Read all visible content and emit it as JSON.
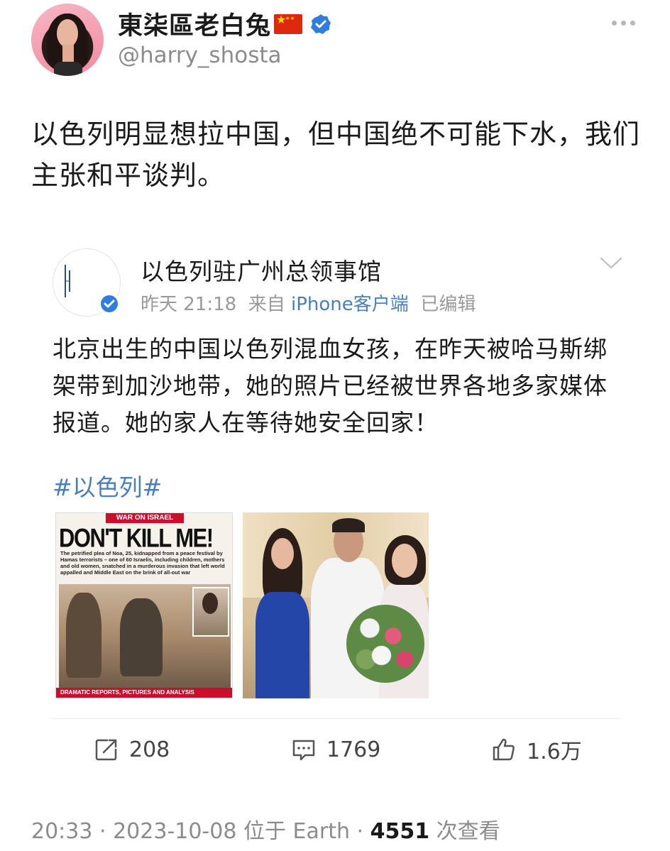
{
  "post": {
    "author": {
      "display_name": "東柒區老白兔",
      "handle": "@harry_shosta",
      "flag_icon": "china-flag-icon",
      "verified_icon": "verified-badge-icon"
    },
    "text": "以色列明显想拉中国，但中国绝不可能下水，我们主张和平谈判。",
    "quoted": {
      "author_name": "以色列驻广州总领事馆",
      "time": "昨天 21:18",
      "from_label": "来自",
      "client": "iPhone客户端",
      "edited": "已编辑",
      "text": "北京出生的中国以色列混血女孩，在昨天被哈马斯绑架带到加沙地带，她的照片已经被世界各地多家媒体报道。她的家人在等待她安全回家！",
      "hashtag": "#以色列#",
      "images": {
        "news": {
          "banner": "WAR ON ISRAEL",
          "headline": "DON'T KILL ME!",
          "subtext": "The petrified plea of Noa, 25, kidnapped from a peace festival by Hamas terrorists – one of 60 Israelis, including children, mothers and old women, snatched in a murderous invasion that left world appalled and Middle East on the brink of all-out war",
          "footer": "DRAMATIC REPORTS, PICTURES AND ANALYSIS"
        }
      }
    },
    "actions": {
      "reposts": "208",
      "comments": "1769",
      "likes": "1.6万"
    },
    "footer": {
      "time": "20:33",
      "date": "2023-10-08",
      "location": "位于 Earth",
      "views": "4551",
      "views_label": "次查看"
    }
  },
  "colors": {
    "link": "#4a7fbf",
    "muted": "#8c8c8c",
    "verified": "#2f7de1"
  }
}
